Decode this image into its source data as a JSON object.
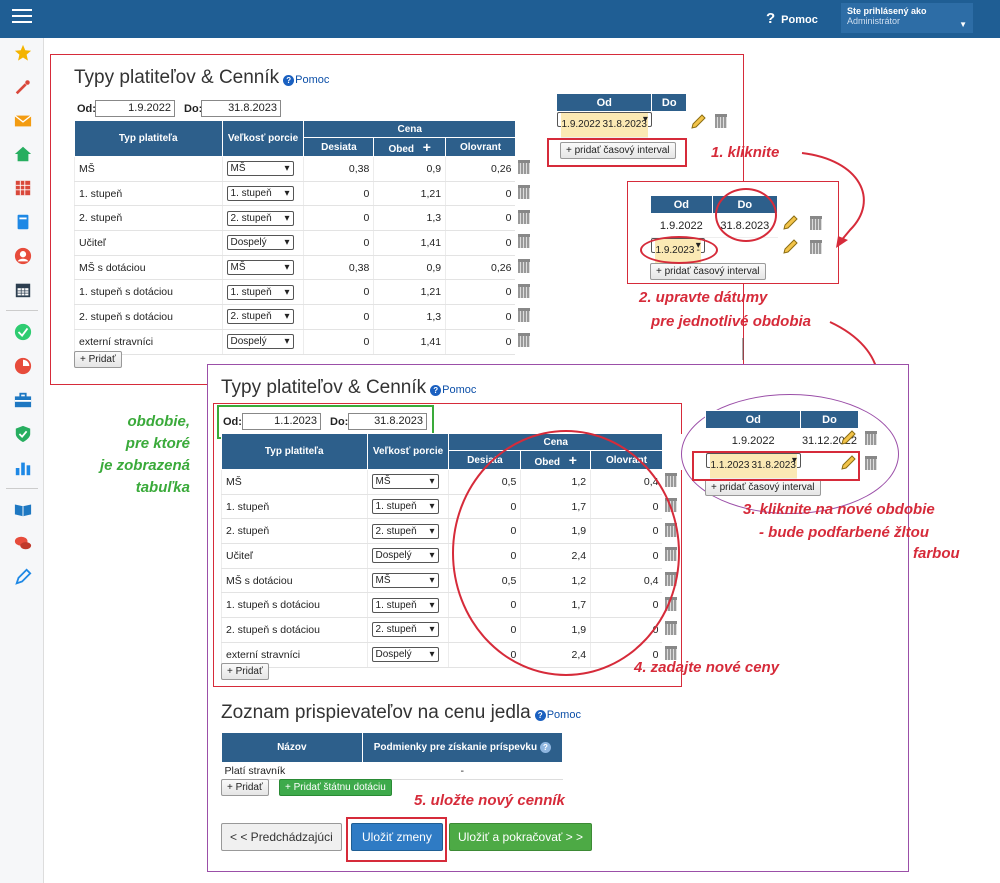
{
  "topbar": {
    "help": "Pomoc",
    "user_line1": "Ste prihlásený ako",
    "user_line2": "Administrátor"
  },
  "sidebar_icons": [
    "star-icon",
    "magic-wand-icon",
    "mail-icon",
    "home-icon",
    "grid-icon",
    "book-icon",
    "user-icon",
    "calendar-icon",
    "check-icon",
    "chart-pie-icon",
    "briefcase-icon",
    "shield-icon",
    "bar-chart-icon",
    "open-book-icon",
    "chat-icon",
    "pen-icon"
  ],
  "panel1": {
    "title": "Typy platiteľov & Cenník",
    "help": "Pomoc",
    "od_label": "Od:",
    "od_value": "1.9.2022",
    "do_label": "Do:",
    "do_value": "31.8.2023",
    "headers": {
      "typ": "Typ platiteľa",
      "velkost": "Veľkosť porcie",
      "cena": "Cena",
      "desiata": "Desiata",
      "obed": "Obed",
      "olovrant": "Olovrant"
    },
    "rows": [
      {
        "typ": "MŠ",
        "velkost": "MŠ",
        "desiata": "0,38",
        "obed": "0,9",
        "olovrant": "0,26"
      },
      {
        "typ": "1. stupeň",
        "velkost": "1. stupeň",
        "desiata": "0",
        "obed": "1,21",
        "olovrant": "0"
      },
      {
        "typ": "2. stupeň",
        "velkost": "2. stupeň",
        "desiata": "0",
        "obed": "1,3",
        "olovrant": "0"
      },
      {
        "typ": "Učiteľ",
        "velkost": "Dospelý",
        "desiata": "0",
        "obed": "1,41",
        "olovrant": "0"
      },
      {
        "typ": "MŠ s dotáciou",
        "velkost": "MŠ",
        "desiata": "0,38",
        "obed": "0,9",
        "olovrant": "0,26"
      },
      {
        "typ": "1. stupeň s dotáciou",
        "velkost": "1. stupeň",
        "desiata": "0",
        "obed": "1,21",
        "olovrant": "0"
      },
      {
        "typ": "2. stupeň s dotáciou",
        "velkost": "2. stupeň",
        "desiata": "0",
        "obed": "1,3",
        "olovrant": "0"
      },
      {
        "typ": "externí stravníci",
        "velkost": "Dospelý",
        "desiata": "0",
        "obed": "1,41",
        "olovrant": "0"
      }
    ],
    "add_button": "+ Pridať"
  },
  "periods1": {
    "od": "Od",
    "do": "Do",
    "rows": [
      {
        "od": "1.9.2022",
        "do": "31.8.2023"
      }
    ],
    "add_interval": "+ pridať časový interval"
  },
  "periods2": {
    "od": "Od",
    "do": "Do",
    "rows": [
      {
        "od": "1.9.2022",
        "do": "31.8.2023"
      },
      {
        "od": "1.9.2023",
        "do": "-"
      }
    ],
    "add_interval": "+ pridať časový interval"
  },
  "periods3": {
    "od": "Od",
    "do": "Do",
    "rows": [
      {
        "od": "1.9.2022",
        "do": "31.12.2022"
      },
      {
        "od": "1.1.2023",
        "do": "31.8.2023"
      }
    ],
    "add_interval": "+ pridať časový interval"
  },
  "panel2": {
    "title": "Typy platiteľov & Cenník",
    "help": "Pomoc",
    "od_label": "Od:",
    "od_value": "1.1.2023",
    "do_label": "Do:",
    "do_value": "31.8.2023",
    "headers": {
      "typ": "Typ platiteľa",
      "velkost": "Veľkosť porcie",
      "cena": "Cena",
      "desiata": "Desiata",
      "obed": "Obed",
      "olovrant": "Olovrant"
    },
    "rows": [
      {
        "typ": "MŠ",
        "velkost": "MŠ",
        "desiata": "0,5",
        "obed": "1,2",
        "olovrant": "0,4"
      },
      {
        "typ": "1. stupeň",
        "velkost": "1. stupeň",
        "desiata": "0",
        "obed": "1,7",
        "olovrant": "0"
      },
      {
        "typ": "2. stupeň",
        "velkost": "2. stupeň",
        "desiata": "0",
        "obed": "1,9",
        "olovrant": "0"
      },
      {
        "typ": "Učiteľ",
        "velkost": "Dospelý",
        "desiata": "0",
        "obed": "2,4",
        "olovrant": "0"
      },
      {
        "typ": "MŠ s dotáciou",
        "velkost": "MŠ",
        "desiata": "0,5",
        "obed": "1,2",
        "olovrant": "0,4"
      },
      {
        "typ": "1. stupeň s dotáciou",
        "velkost": "1. stupeň",
        "desiata": "0",
        "obed": "1,7",
        "olovrant": "0"
      },
      {
        "typ": "2. stupeň s dotáciou",
        "velkost": "2. stupeň",
        "desiata": "0",
        "obed": "1,9",
        "olovrant": "0"
      },
      {
        "typ": "externí stravníci",
        "velkost": "Dospelý",
        "desiata": "0",
        "obed": "2,4",
        "olovrant": "0"
      }
    ],
    "add_button": "+ Pridať"
  },
  "zoznam": {
    "title": "Zoznam prispievateľov na cenu jedla",
    "help": "Pomoc",
    "col_nazov": "Názov",
    "col_podmienky": "Podmienky pre získanie príspevku",
    "row_nazov": "Platí stravník",
    "row_podmienky": "-",
    "add_button": "+ Pridať",
    "add_state": "+ Pridať štátnu dotáciu"
  },
  "footer": {
    "prev": "< < Predchádzajúci",
    "save": "Uložiť zmeny",
    "save_continue": "Uložiť a pokračovať > >"
  },
  "annotations": {
    "a1": "1.  kliknite",
    "a2_line1": "2. upravte dátumy",
    "a2_line2": "pre jednotlivé obdobia",
    "a3_line1": "3. kliknite na nové obdobie",
    "a3_line2": "- bude podfarbené žltou",
    "a3_line3": "farbou",
    "a4": "4. zadajte nové ceny",
    "a5": "5.  uložte nový cenník",
    "green_line1": "obdobie,",
    "green_line2": "pre ktoré",
    "green_line3": "je zobrazená",
    "green_line4": "tabuľka"
  },
  "colors": {
    "topbar": "#1f5e94",
    "table_header": "#2d5f8b",
    "annotation_red": "#d62b3a",
    "annotation_green": "#3aaa3a",
    "selected_row": "#fbe9b4"
  }
}
